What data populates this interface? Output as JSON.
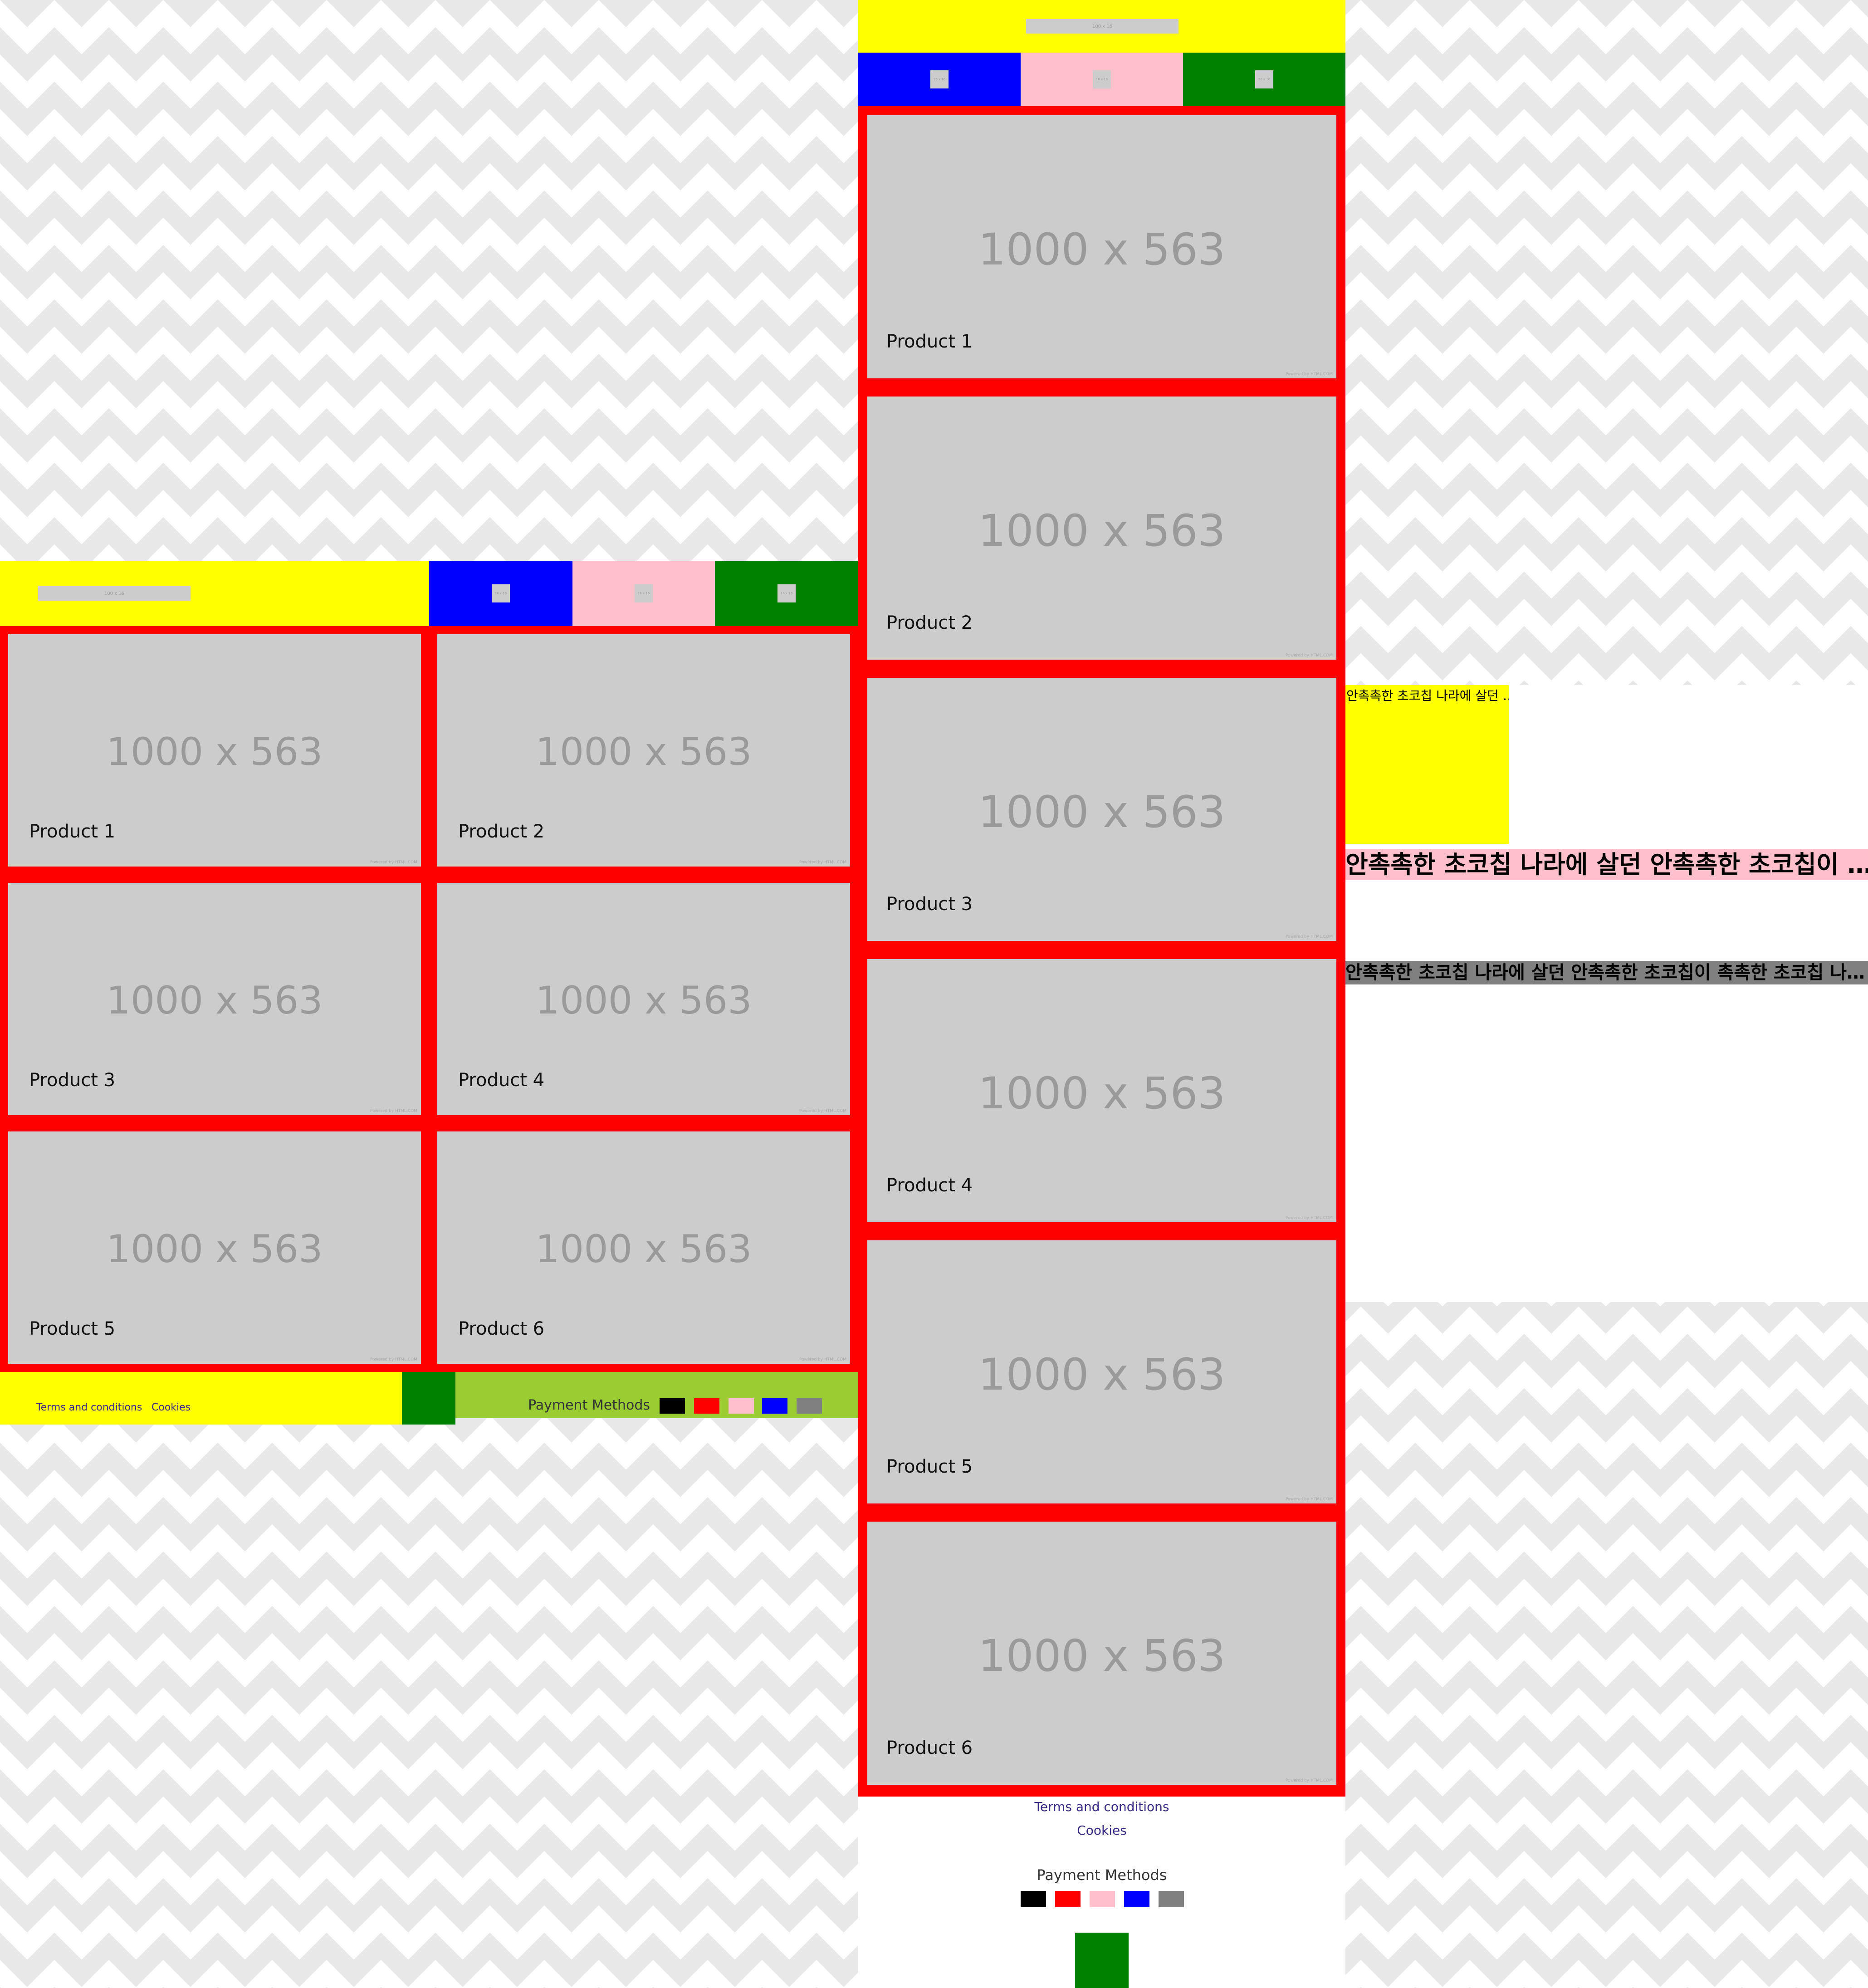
{
  "logo_placeholder": "100 x 16",
  "icon_placeholder": "16 x 16",
  "products": [
    {
      "label": "Product 1",
      "size": "1000 x 563",
      "powered": "Powered by HTML.COM"
    },
    {
      "label": "Product 2",
      "size": "1000 x 563",
      "powered": "Powered by HTML.COM"
    },
    {
      "label": "Product 3",
      "size": "1000 x 563",
      "powered": "Powered by HTML.COM"
    },
    {
      "label": "Product 4",
      "size": "1000 x 563",
      "powered": "Powered by HTML.COM"
    },
    {
      "label": "Product 5",
      "size": "1000 x 563",
      "powered": "Powered by HTML.COM"
    },
    {
      "label": "Product 6",
      "size": "1000 x 563",
      "powered": "Powered by HTML.COM"
    }
  ],
  "footer": {
    "terms": "Terms and conditions",
    "cookies": "Cookies",
    "payment_methods": "Payment Methods",
    "payment_colors": [
      "#000000",
      "#ff0000",
      "#ffc0cb",
      "#0000ff",
      "#808080"
    ]
  },
  "nav_colors": [
    "#0000ff",
    "#ffc0cb",
    "#008000"
  ],
  "korean": {
    "small": "안촉촉한 초코칩 나라에 살던 …",
    "large": "안촉촉한 초코칩 나라에 살던 안촉촉한 초코칩이 …",
    "medium": "안촉촉한 초코칩 나라에 살던 안촉촉한 초코칩이 촉촉한 초코칩 나…"
  }
}
